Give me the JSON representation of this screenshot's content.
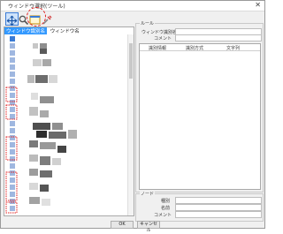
{
  "window": {
    "title": "ウィンドウ選択(ツール)",
    "close_glyph": "✕"
  },
  "toolbar": {
    "icons": [
      "drag-target-icon",
      "magnifier-icon",
      "window-frame-icon",
      "settings-icon"
    ]
  },
  "tree": {
    "columns": [
      "ウィンドウ識別名",
      "ウィンドウ名"
    ],
    "selected_col": 0
  },
  "right_panel": {
    "group1": {
      "title": "ルール",
      "field1_label": "ウィンドウ識別名",
      "field2_label": "コメント"
    },
    "list": {
      "col1": "識別情報",
      "col2": "識別方式",
      "col3": "文字列"
    },
    "group2": {
      "title": "ノード",
      "f1": "種別",
      "f2": "名前",
      "f3": "コメント"
    }
  },
  "buttons": {
    "ok": "OK",
    "cancel": "キャンセル"
  },
  "colors": {
    "accent": "#3399ff",
    "highlight_ring": "#e02020"
  }
}
